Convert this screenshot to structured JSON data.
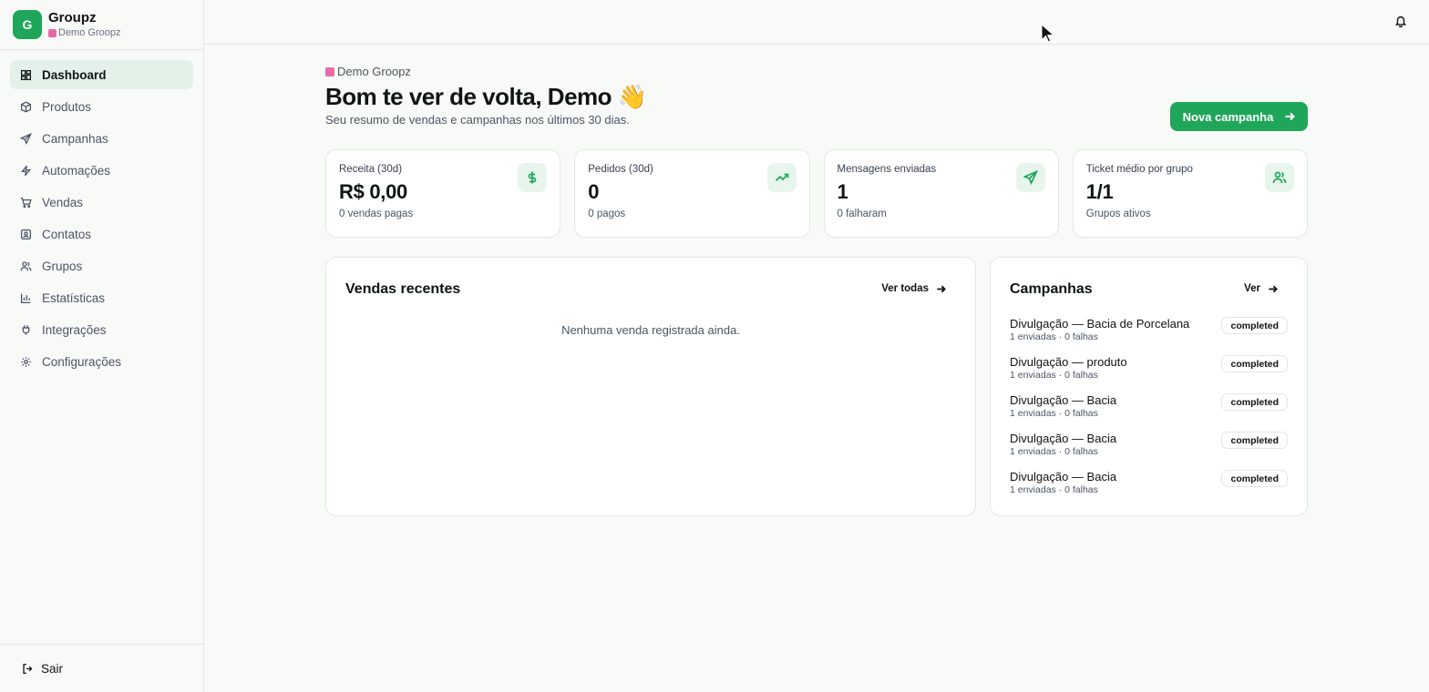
{
  "brand": {
    "logo_letter": "G",
    "name": "Groupz",
    "workspace": "Demo Groopz"
  },
  "nav": [
    {
      "label": "Dashboard",
      "icon": "dashboard-icon",
      "active": true
    },
    {
      "label": "Produtos",
      "icon": "box-icon"
    },
    {
      "label": "Campanhas",
      "icon": "send-icon"
    },
    {
      "label": "Automações",
      "icon": "bolt-icon"
    },
    {
      "label": "Vendas",
      "icon": "cart-icon"
    },
    {
      "label": "Contatos",
      "icon": "contact-icon"
    },
    {
      "label": "Grupos",
      "icon": "users-icon"
    },
    {
      "label": "Estatísticas",
      "icon": "bar-chart-icon"
    },
    {
      "label": "Integrações",
      "icon": "plug-icon"
    },
    {
      "label": "Configurações",
      "icon": "gear-icon"
    }
  ],
  "logout": {
    "label": "Sair"
  },
  "header": {
    "eyebrow": "Demo Groopz",
    "title": "Bom te ver de volta, Demo 👋",
    "subtitle": "Seu resumo de vendas e campanhas nos últimos 30 dias.",
    "cta": "Nova campanha"
  },
  "stats": [
    {
      "label": "Receita (30d)",
      "value": "R$ 0,00",
      "sub": "0 vendas pagas",
      "icon": "dollar-icon"
    },
    {
      "label": "Pedidos (30d)",
      "value": "0",
      "sub": "0 pagos",
      "icon": "trending-up-icon"
    },
    {
      "label": "Mensagens enviadas",
      "value": "1",
      "sub": "0 falharam",
      "icon": "send-icon"
    },
    {
      "label": "Ticket médio por grupo",
      "value": "1/1",
      "sub": "Grupos ativos",
      "icon": "users-icon"
    }
  ],
  "sales_panel": {
    "title": "Vendas recentes",
    "link": "Ver todas",
    "empty": "Nenhuma venda registrada ainda."
  },
  "campaigns_panel": {
    "title": "Campanhas",
    "link": "Ver",
    "items": [
      {
        "name": "Divulgação — Bacia de Porcelana",
        "meta": "1 enviadas · 0 falhas",
        "status": "completed"
      },
      {
        "name": "Divulgação — produto",
        "meta": "1 enviadas · 0 falhas",
        "status": "completed"
      },
      {
        "name": "Divulgação — Bacia",
        "meta": "1 enviadas · 0 falhas",
        "status": "completed"
      },
      {
        "name": "Divulgação — Bacia",
        "meta": "1 enviadas · 0 falhas",
        "status": "completed"
      },
      {
        "name": "Divulgação — Bacia",
        "meta": "1 enviadas · 0 falhas",
        "status": "completed"
      }
    ]
  },
  "colors": {
    "accent": "#1fa65a",
    "active_nav_bg": "#e4f1e8",
    "icon_bg": "#e8f5ec"
  }
}
